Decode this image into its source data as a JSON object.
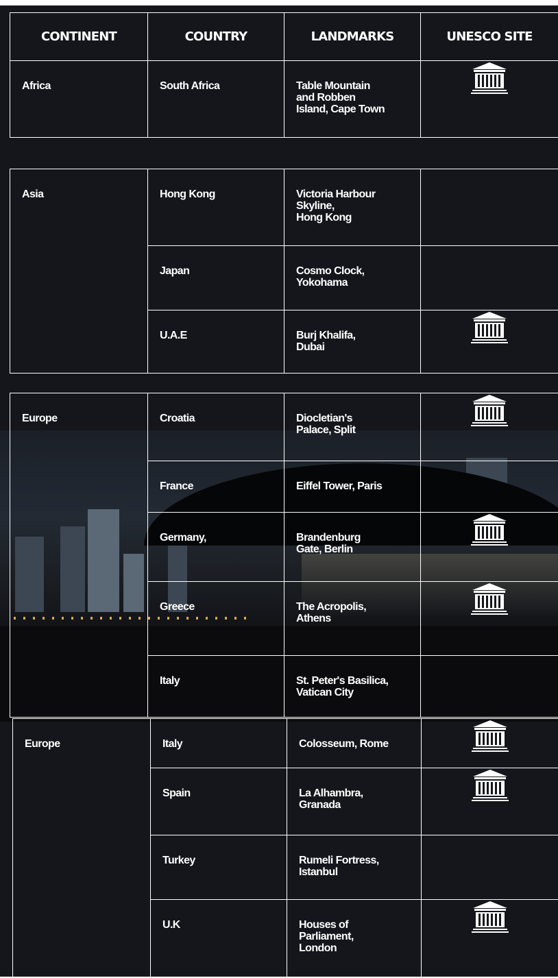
{
  "header": {
    "continent": "CONTINENT",
    "country": "COUNTRY",
    "landmarks": "LANDMARKS",
    "unesco": "UNESCO SITE"
  },
  "unesco_icon": "unesco-temple-icon",
  "colors": {
    "background": "#15161c",
    "lines": "#ffffff",
    "text": "#ffffff",
    "city_lights": "#f6c35a"
  },
  "africa": {
    "continent": "Africa",
    "rows": [
      {
        "country": "South Africa",
        "landmark": [
          "Table Mountain",
          "and Robben",
          "Island, Cape Town"
        ],
        "unesco": true
      }
    ]
  },
  "asia": {
    "continent": "Asia",
    "rows": [
      {
        "country": "Hong Kong",
        "landmark": [
          "Victoria Harbour",
          "Skyline,",
          "Hong Kong"
        ],
        "unesco": false
      },
      {
        "country": "Japan",
        "landmark": [
          "Cosmo Clock,",
          "Yokohama"
        ],
        "unesco": false
      },
      {
        "country": "U.A.E",
        "landmark": [
          "Burj Khalifa,",
          "Dubai"
        ],
        "unesco": true
      }
    ]
  },
  "europe1": {
    "continent": "Europe",
    "rows": [
      {
        "country": "Croatia",
        "landmark": [
          "Diocletian's",
          "Palace, Split"
        ],
        "unesco": true
      },
      {
        "country": "France",
        "landmark": [
          "Eiffel Tower, Paris"
        ],
        "unesco": false
      },
      {
        "country": "Germany,",
        "landmark": [
          "Brandenburg",
          "Gate, Berlin"
        ],
        "unesco": true
      },
      {
        "country": "Greece",
        "landmark": [
          "The Acropolis,",
          "Athens"
        ],
        "unesco": true
      },
      {
        "country": "Italy",
        "landmark": [
          "St. Peter's Basilica,",
          "Vatican City"
        ],
        "unesco": false
      }
    ]
  },
  "europe2": {
    "continent": "Europe",
    "rows": [
      {
        "country": "Italy",
        "landmark": [
          "Colosseum, Rome"
        ],
        "unesco": true
      },
      {
        "country": "Spain",
        "landmark": [
          "La Alhambra,",
          "Granada"
        ],
        "unesco": true
      },
      {
        "country": "Turkey",
        "landmark": [
          "Rumeli Fortress,",
          "Istanbul"
        ],
        "unesco": false
      },
      {
        "country": "U.K",
        "landmark": [
          "Houses of",
          "Parliament,",
          "London"
        ],
        "unesco": true
      }
    ]
  }
}
